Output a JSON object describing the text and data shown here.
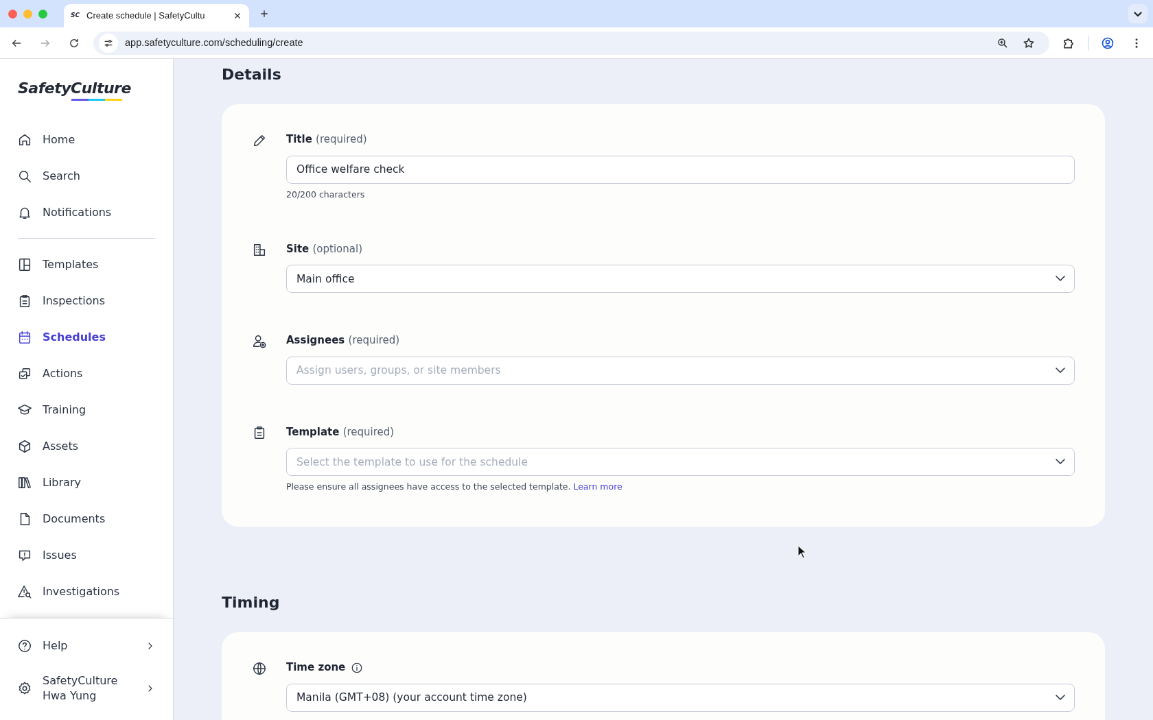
{
  "browser": {
    "tab_title": "Create schedule | SafetyCultu",
    "favicon": "SC",
    "url": "app.safetyculture.com/scheduling/create"
  },
  "sidebar": {
    "logo": "SafetyCulture",
    "items": [
      {
        "label": "Home",
        "selected": false
      },
      {
        "label": "Search",
        "selected": false
      },
      {
        "label": "Notifications",
        "selected": false
      },
      {
        "label": "Templates",
        "selected": false
      },
      {
        "label": "Inspections",
        "selected": false
      },
      {
        "label": "Schedules",
        "selected": true
      },
      {
        "label": "Actions",
        "selected": false
      },
      {
        "label": "Training",
        "selected": false
      },
      {
        "label": "Assets",
        "selected": false
      },
      {
        "label": "Library",
        "selected": false
      },
      {
        "label": "Documents",
        "selected": false
      },
      {
        "label": "Issues",
        "selected": false
      },
      {
        "label": "Investigations",
        "selected": false
      }
    ],
    "footer": [
      {
        "lines": [
          "Help"
        ]
      },
      {
        "lines": [
          "SafetyCulture",
          "Hwa Yung"
        ]
      }
    ]
  },
  "details": {
    "heading": "Details",
    "fields": [
      {
        "kind": "text",
        "label": "Title",
        "qualifier": "(required)",
        "value": "Office welfare check",
        "help": "20/200 characters"
      },
      {
        "kind": "select",
        "label": "Site",
        "qualifier": "(optional)",
        "value": "Main office"
      },
      {
        "kind": "select",
        "label": "Assignees",
        "qualifier": "(required)",
        "placeholder": "Assign users, groups, or site members"
      },
      {
        "kind": "select",
        "label": "Template",
        "qualifier": "(required)",
        "placeholder": "Select the template to use for the schedule",
        "help": "Please ensure all assignees have access to the selected template.",
        "link": "Learn more"
      }
    ]
  },
  "timing": {
    "heading": "Timing",
    "fields": [
      {
        "kind": "select",
        "label": "Time zone",
        "info": true,
        "value": "Manila (GMT+08) (your account time zone)"
      }
    ]
  }
}
